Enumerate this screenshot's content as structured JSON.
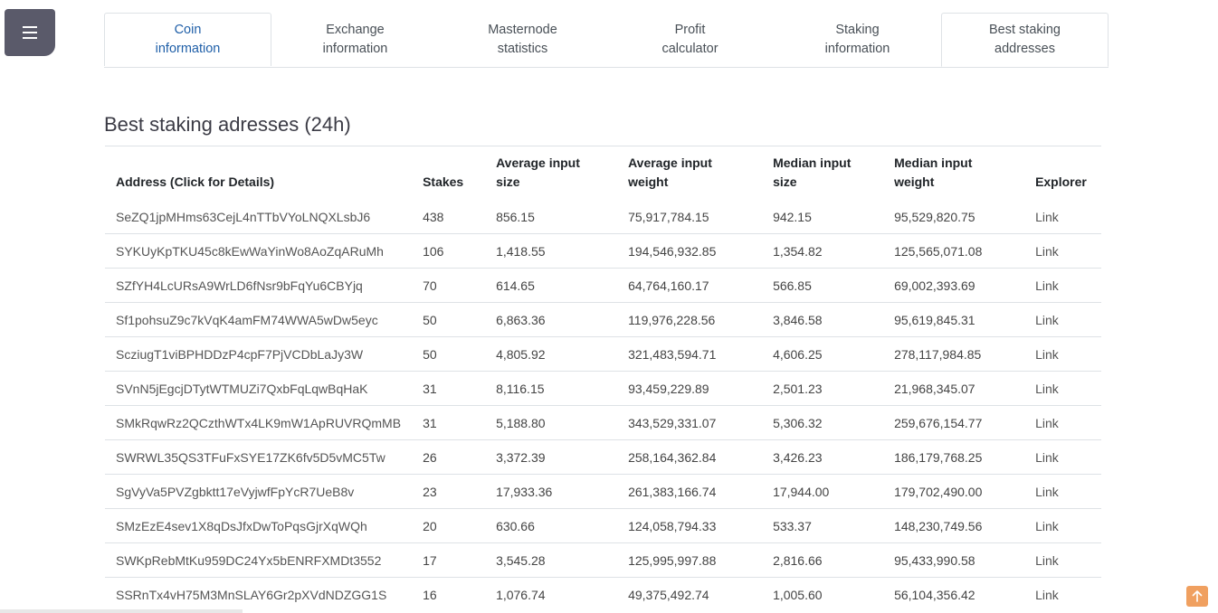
{
  "tabs": [
    {
      "label_line1": "Coin",
      "label_line2": "information"
    },
    {
      "label_line1": "Exchange",
      "label_line2": "information"
    },
    {
      "label_line1": "Masternode",
      "label_line2": "statistics"
    },
    {
      "label_line1": "Profit",
      "label_line2": "calculator"
    },
    {
      "label_line1": "Staking",
      "label_line2": "information"
    },
    {
      "label_line1": "Best staking",
      "label_line2": "addresses"
    }
  ],
  "page_title": "Best staking adresses (24h)",
  "table": {
    "headers": {
      "address": "Address (Click for Details)",
      "stakes": "Stakes",
      "avg_input_size_1": "Average input",
      "avg_input_size_2": "size",
      "avg_input_weight_1": "Average input",
      "avg_input_weight_2": "weight",
      "median_input_size_1": "Median input",
      "median_input_size_2": "size",
      "median_input_weight_1": "Median input",
      "median_input_weight_2": "weight",
      "explorer": "Explorer"
    },
    "rows": [
      {
        "address": "SeZQ1jpMHms63CejL4nTTbVYoLNQXLsbJ6",
        "stakes": "438",
        "avg_size": "856.15",
        "avg_weight": "75,917,784.15",
        "med_size": "942.15",
        "med_weight": "95,529,820.75",
        "link": "Link"
      },
      {
        "address": "SYKUyKpTKU45c8kEwWaYinWo8AoZqARuMh",
        "stakes": "106",
        "avg_size": "1,418.55",
        "avg_weight": "194,546,932.85",
        "med_size": "1,354.82",
        "med_weight": "125,565,071.08",
        "link": "Link"
      },
      {
        "address": "SZfYH4LcURsA9WrLD6fNsr9bFqYu6CBYjq",
        "stakes": "70",
        "avg_size": "614.65",
        "avg_weight": "64,764,160.17",
        "med_size": "566.85",
        "med_weight": "69,002,393.69",
        "link": "Link"
      },
      {
        "address": "Sf1pohsuZ9c7kVqK4amFM74WWA5wDw5eyc",
        "stakes": "50",
        "avg_size": "6,863.36",
        "avg_weight": "119,976,228.56",
        "med_size": "3,846.58",
        "med_weight": "95,619,845.31",
        "link": "Link"
      },
      {
        "address": "ScziugT1viBPHDDzP4cpF7PjVCDbLaJy3W",
        "stakes": "50",
        "avg_size": "4,805.92",
        "avg_weight": "321,483,594.71",
        "med_size": "4,606.25",
        "med_weight": "278,117,984.85",
        "link": "Link"
      },
      {
        "address": "SVnN5jEgcjDTytWTMUZi7QxbFqLqwBqHaK",
        "stakes": "31",
        "avg_size": "8,116.15",
        "avg_weight": "93,459,229.89",
        "med_size": "2,501.23",
        "med_weight": "21,968,345.07",
        "link": "Link"
      },
      {
        "address": "SMkRqwRz2QCzthWTx4LK9mW1ApRUVRQmMB",
        "stakes": "31",
        "avg_size": "5,188.80",
        "avg_weight": "343,529,331.07",
        "med_size": "5,306.32",
        "med_weight": "259,676,154.77",
        "link": "Link"
      },
      {
        "address": "SWRWL35QS3TFuFxSYE17ZK6fv5D5vMC5Tw",
        "stakes": "26",
        "avg_size": "3,372.39",
        "avg_weight": "258,164,362.84",
        "med_size": "3,426.23",
        "med_weight": "186,179,768.25",
        "link": "Link"
      },
      {
        "address": "SgVyVa5PVZgbktt17eVyjwfFpYcR7UeB8v",
        "stakes": "23",
        "avg_size": "17,933.36",
        "avg_weight": "261,383,166.74",
        "med_size": "17,944.00",
        "med_weight": "179,702,490.00",
        "link": "Link"
      },
      {
        "address": "SMzEzE4sev1X8qDsJfxDwToPqsGjrXqWQh",
        "stakes": "20",
        "avg_size": "630.66",
        "avg_weight": "124,058,794.33",
        "med_size": "533.37",
        "med_weight": "148,230,749.56",
        "link": "Link"
      },
      {
        "address": "SWKpRebMtKu959DC24Yx5bENRFXMDt3552",
        "stakes": "17",
        "avg_size": "3,545.28",
        "avg_weight": "125,995,997.88",
        "med_size": "2,816.66",
        "med_weight": "95,433,990.58",
        "link": "Link"
      },
      {
        "address": "SSRnTx4vH75M3MnSLAY6Gr2pXVdNDZGG1S",
        "stakes": "16",
        "avg_size": "1,076.74",
        "avg_weight": "49,375,492.74",
        "med_size": "1,005.60",
        "med_weight": "56,104,356.42",
        "link": "Link"
      }
    ]
  },
  "icons": {
    "menu": "hamburger-icon",
    "scroll_top": "arrow-up-icon"
  },
  "colors": {
    "menu_button": "#5a5a6a",
    "active_tab_text": "#1f5fa8",
    "scroll_top_button": "#f0a060"
  }
}
